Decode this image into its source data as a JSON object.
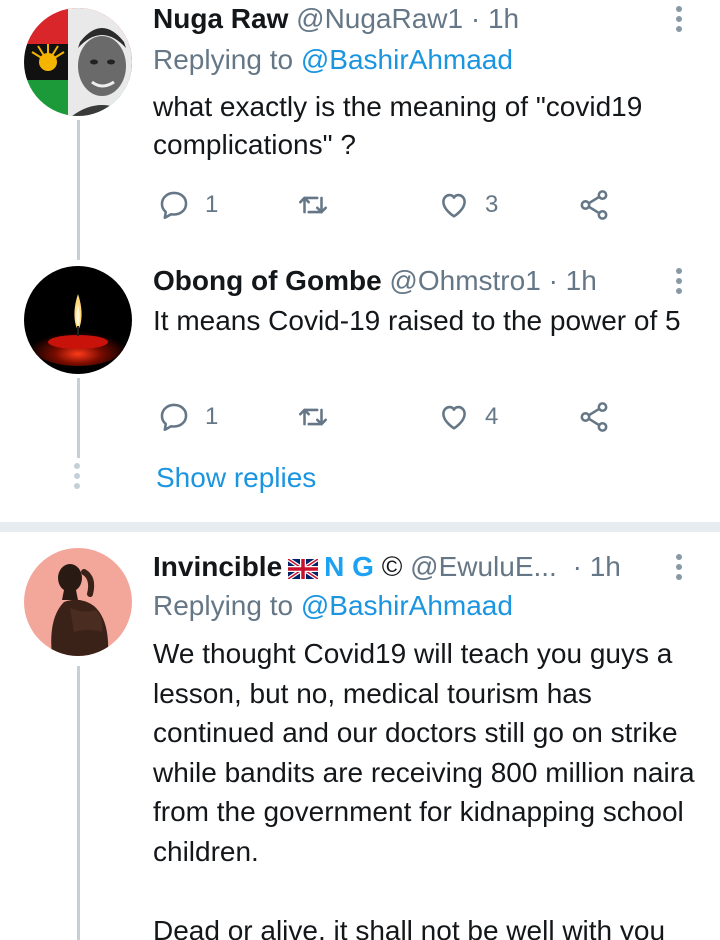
{
  "tweets": [
    {
      "name": "Nuga  Raw",
      "handle": "@NugaRaw1",
      "time": "· 1h",
      "replying_label": "Replying to",
      "replying_mention": "@BashirAhmaad",
      "text": "what exactly is the meaning of \"covid19 complications\" ?",
      "reply_count": "1",
      "like_count": "3"
    },
    {
      "name": "Obong of Gombe",
      "handle": "@Ohmstro1",
      "time": "· 1h",
      "text": "It means Covid-19 raised to the power of 5",
      "reply_count": "1",
      "like_count": "4"
    },
    {
      "name": "Invincible",
      "name_suffix": "N G",
      "copyright": "©",
      "handle": "@EwuluE...",
      "time": "· 1h",
      "replying_label": "Replying to",
      "replying_mention": "@BashirAhmaad",
      "text": "We thought Covid19 will teach you guys a lesson, but no, medical tourism has continued and our doctors still go on strike while bandits are receiving 800 million naira from the government for kidnapping school children.\n\nDead or alive, it shall not be well with you"
    }
  ],
  "show_replies": "Show replies",
  "icons": {
    "reply": "reply-icon",
    "retweet": "retweet-icon",
    "like": "heart-icon",
    "share": "share-icon",
    "more": "more-vertical-icon"
  },
  "colors": {
    "link": "#1b95e0",
    "secondary": "#657786",
    "thread_line": "#c4cfd6"
  }
}
